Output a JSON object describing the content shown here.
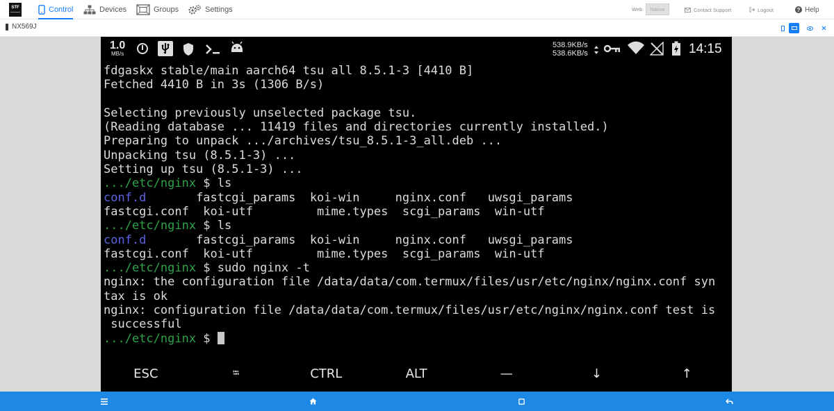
{
  "nav": {
    "logo_text": "STF",
    "items": [
      {
        "label": "Control",
        "icon": "phone-icon",
        "active": true
      },
      {
        "label": "Devices",
        "icon": "sitemap-icon",
        "active": false
      },
      {
        "label": "Groups",
        "icon": "groups-icon",
        "active": false
      },
      {
        "label": "Settings",
        "icon": "gears-icon",
        "active": false
      }
    ],
    "web_label": "Web",
    "native_label": "Native",
    "contact_label": "Contact Support",
    "logout_label": "Logout",
    "help_label": "Help",
    "accent": "#157efb"
  },
  "device": {
    "name": "NX569J"
  },
  "statusbar": {
    "speed_value": "1.0",
    "speed_unit": "MB/s",
    "rate_down": "538.9KB/s",
    "rate_up": "538.6KB/s",
    "time": "14:15"
  },
  "terminal": {
    "lines": [
      {
        "segments": [
          {
            "text": "fdgaskx stable/main aarch64 tsu all 8.5.1-3 [4410 B]",
            "color": "w"
          }
        ]
      },
      {
        "segments": [
          {
            "text": "Fetched 4410 B in 3s (1306 B/s)",
            "color": "w"
          }
        ]
      },
      {
        "segments": [
          {
            "text": "",
            "color": "w"
          }
        ]
      },
      {
        "segments": [
          {
            "text": "Selecting previously unselected package tsu.",
            "color": "w"
          }
        ]
      },
      {
        "segments": [
          {
            "text": "(Reading database ... 11419 files and directories currently installed.)",
            "color": "w"
          }
        ]
      },
      {
        "segments": [
          {
            "text": "Preparing to unpack .../archives/tsu_8.5.1-3_all.deb ...",
            "color": "w"
          }
        ]
      },
      {
        "segments": [
          {
            "text": "Unpacking tsu (8.5.1-3) ...",
            "color": "w"
          }
        ]
      },
      {
        "segments": [
          {
            "text": "Setting up tsu (8.5.1-3) ...",
            "color": "w"
          }
        ]
      },
      {
        "segments": [
          {
            "text": ".../etc/nginx",
            "color": "g"
          },
          {
            "text": " $ ls",
            "color": "w"
          }
        ]
      },
      {
        "segments": [
          {
            "text": "conf.d",
            "color": "b"
          },
          {
            "text": "       fastcgi_params  koi-win     nginx.conf   uwsgi_params",
            "color": "w"
          }
        ]
      },
      {
        "segments": [
          {
            "text": "fastcgi.conf  koi-utf         mime.types  scgi_params  win-utf",
            "color": "w"
          }
        ]
      },
      {
        "segments": [
          {
            "text": ".../etc/nginx",
            "color": "g"
          },
          {
            "text": " $ ls",
            "color": "w"
          }
        ]
      },
      {
        "segments": [
          {
            "text": "conf.d",
            "color": "b"
          },
          {
            "text": "       fastcgi_params  koi-win     nginx.conf   uwsgi_params",
            "color": "w"
          }
        ]
      },
      {
        "segments": [
          {
            "text": "fastcgi.conf  koi-utf         mime.types  scgi_params  win-utf",
            "color": "w"
          }
        ]
      },
      {
        "segments": [
          {
            "text": ".../etc/nginx",
            "color": "g"
          },
          {
            "text": " $ sudo nginx -t",
            "color": "w"
          }
        ]
      },
      {
        "segments": [
          {
            "text": "nginx: the configuration file /data/data/com.termux/files/usr/etc/nginx/nginx.conf syn",
            "color": "w"
          }
        ]
      },
      {
        "segments": [
          {
            "text": "tax is ok",
            "color": "w"
          }
        ]
      },
      {
        "segments": [
          {
            "text": "nginx: configuration file /data/data/com.termux/files/usr/etc/nginx/nginx.conf test is",
            "color": "w"
          }
        ]
      },
      {
        "segments": [
          {
            "text": " successful",
            "color": "w"
          }
        ]
      },
      {
        "segments": [
          {
            "text": ".../etc/nginx",
            "color": "g"
          },
          {
            "text": " $ ",
            "color": "w"
          }
        ],
        "cursor": true
      }
    ]
  },
  "extrakeys": [
    "ESC",
    "⭾",
    "CTRL",
    "ALT",
    "—",
    "↓",
    "↑"
  ],
  "bottombar": {
    "menu_icon": "menu-icon",
    "home_icon": "home-icon",
    "recents_icon": "recents-icon",
    "back_icon": "back-icon",
    "color": "#1e88e5"
  }
}
